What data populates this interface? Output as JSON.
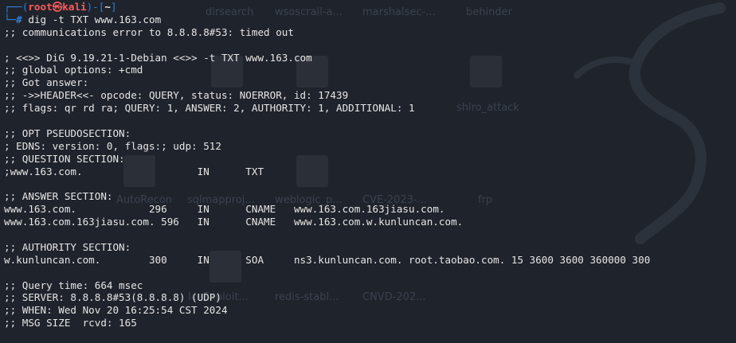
{
  "desktop": {
    "icon_labels": [
      "dirsearch",
      "wsoscrail-a...",
      "marshalsec-...",
      "behinder",
      "shiro_attack",
      "AutoRecon",
      "sqlmapproj...",
      "weblogic_p...",
      "CVE-2023-...",
      "frp",
      "IceExploit...",
      "redis-stabl...",
      "CNVD-202..."
    ],
    "colors": {
      "background": "#1f232b",
      "label": "#3a4250"
    }
  },
  "prompt": {
    "user": "root",
    "at_icon": "skull-icon",
    "host": "kali",
    "dir": "~",
    "hash": "#",
    "command": "dig -t TXT www.163.com",
    "colors": {
      "frame": "#2f7fd8",
      "user": "#ff5a5a"
    }
  },
  "output": [
    ";; communications error to 8.8.8.8#53: timed out",
    "",
    "; <<>> DiG 9.19.21-1-Debian <<>> -t TXT www.163.com",
    ";; global options: +cmd",
    ";; Got answer:",
    ";; ->>HEADER<<- opcode: QUERY, status: NOERROR, id: 17439",
    ";; flags: qr rd ra; QUERY: 1, ANSWER: 2, AUTHORITY: 1, ADDITIONAL: 1",
    "",
    ";; OPT PSEUDOSECTION:",
    "; EDNS: version: 0, flags:; udp: 512",
    ";; QUESTION SECTION:",
    ";www.163.com.                   IN      TXT",
    "",
    ";; ANSWER SECTION:",
    "www.163.com.            296     IN      CNAME   www.163.com.163jiasu.com.",
    "www.163.com.163jiasu.com. 596   IN      CNAME   www.163.com.w.kunluncan.com.",
    "",
    ";; AUTHORITY SECTION:",
    "w.kunluncan.com.        300     IN      SOA     ns3.kunluncan.com. root.taobao.com. 15 3600 3600 360000 300",
    "",
    ";; Query time: 664 msec",
    ";; SERVER: 8.8.8.8#53(8.8.8.8) (UDP)",
    ";; WHEN: Wed Nov 20 16:25:54 CST 2024",
    ";; MSG SIZE  rcvd: 165"
  ]
}
